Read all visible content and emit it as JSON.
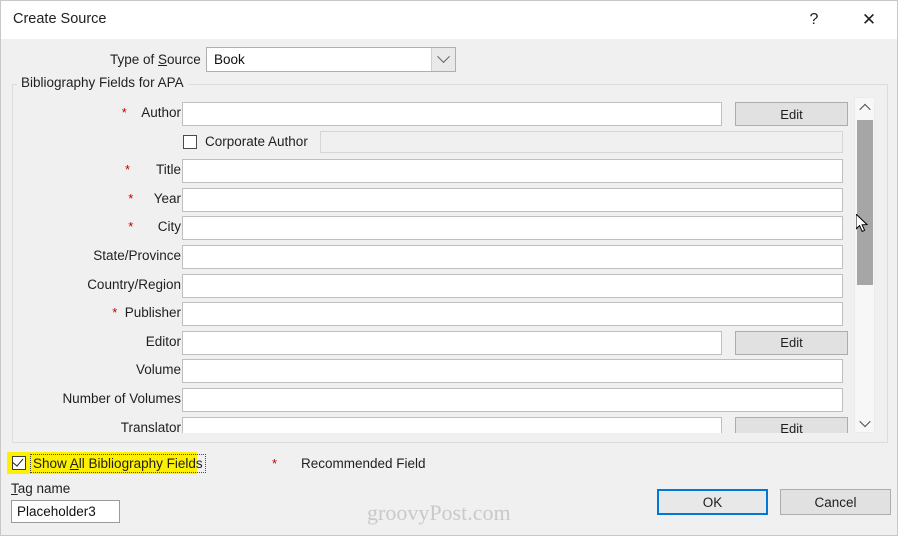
{
  "window": {
    "title": "Create Source",
    "help_icon": "question-mark-icon",
    "close_icon": "close-icon"
  },
  "source_type": {
    "label_pre": "Type of ",
    "label_accel": "S",
    "label_post": "ource",
    "value": "Book",
    "dropdown_icon": "chevron-down-icon"
  },
  "group": {
    "title": "Bibliography Fields for APA"
  },
  "fields": [
    {
      "label": "Author",
      "value": "",
      "required": true,
      "edit_label": "Edit",
      "has_edit": true,
      "input_width": "short"
    },
    {
      "label": "Title",
      "value": "",
      "required": true,
      "has_edit": false,
      "input_width": "wide"
    },
    {
      "label": "Year",
      "value": "",
      "required": true,
      "has_edit": false,
      "input_width": "wide"
    },
    {
      "label": "City",
      "value": "",
      "required": true,
      "has_edit": false,
      "input_width": "wide"
    },
    {
      "label": "State/Province",
      "value": "",
      "required": false,
      "has_edit": false,
      "input_width": "wide"
    },
    {
      "label": "Country/Region",
      "value": "",
      "required": false,
      "has_edit": false,
      "input_width": "wide"
    },
    {
      "label": "Publisher",
      "value": "",
      "required": true,
      "has_edit": false,
      "input_width": "wide"
    },
    {
      "label": "Editor",
      "value": "",
      "required": false,
      "edit_label": "Edit",
      "has_edit": true,
      "input_width": "short"
    },
    {
      "label": "Volume",
      "value": "",
      "required": false,
      "has_edit": false,
      "input_width": "wide"
    },
    {
      "label": "Number of Volumes",
      "value": "",
      "required": false,
      "has_edit": false,
      "input_width": "wide"
    },
    {
      "label": "Translator",
      "value": "",
      "required": false,
      "edit_label": "Edit",
      "has_edit": true,
      "input_width": "short"
    }
  ],
  "corporate_author": {
    "label": "Corporate Author",
    "checked": false,
    "value": "",
    "disabled": true
  },
  "scrollbar": {
    "up_icon": "chevron-up-icon",
    "down_icon": "chevron-down-icon"
  },
  "footer": {
    "show_all_pre": "Show ",
    "show_all_accel": "A",
    "show_all_post": "ll Bibliography Fields",
    "show_all_checked": true,
    "legend_star": "*",
    "legend_text": "Recommended Field",
    "tag_label_accel": "T",
    "tag_label_post": "ag name",
    "tag_value": "Placeholder3",
    "ok_label": "OK",
    "cancel_label": "Cancel",
    "watermark": "groovyPost.com"
  },
  "colors": {
    "required_star": "#c00000",
    "highlight": "#fdf000",
    "default_button_border": "#0078d7",
    "dialog_background": "#f0f0f0"
  }
}
